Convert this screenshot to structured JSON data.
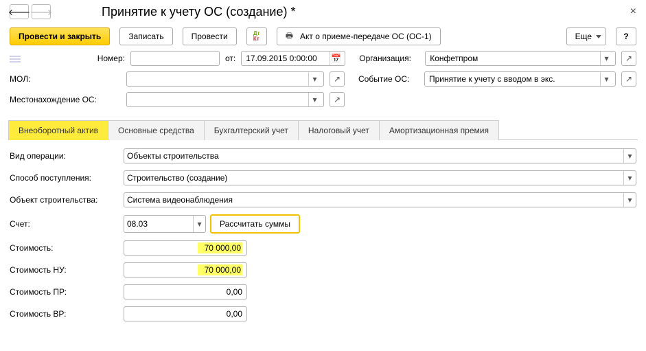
{
  "title": "Принятие к учету ОС (создание) *",
  "nav": {
    "back": "🡐",
    "fwd": "🡒"
  },
  "toolbar": {
    "primary": "Провести и закрыть",
    "save": "Записать",
    "post": "Провести",
    "dtk_top": "Дт",
    "dtk_bottom": "Кт",
    "print": "Акт о приеме-передаче ОС (ОС-1)",
    "more": "Еще",
    "help": "?"
  },
  "header": {
    "number_label": "Номер:",
    "number_value": "",
    "from_label": "от:",
    "date_value": "17.09.2015 0:00:00",
    "org_label": "Организация:",
    "org_value": "Конфетпром",
    "mol_label": "МОЛ:",
    "mol_value": "",
    "event_label": "Событие ОС:",
    "event_value": "Принятие к учету с вводом в экс.",
    "loc_label": "Местонахождение ОС:",
    "loc_value": ""
  },
  "tabs": [
    "Внеоборотный актив",
    "Основные средства",
    "Бухгалтерский учет",
    "Налоговый учет",
    "Амортизационная премия"
  ],
  "active_tab": 0,
  "vna": {
    "op_label": "Вид операции:",
    "op_value": "Объекты строительства",
    "method_label": "Способ поступления:",
    "method_value": "Строительство (создание)",
    "obj_label": "Объект строительства:",
    "obj_value": "Система видеонаблюдения",
    "acct_label": "Счет:",
    "acct_value": "08.03",
    "calc": "Рассчитать суммы",
    "cost_label": "Стоимость:",
    "cost_value": "70 000,00",
    "cost_nu_label": "Стоимость НУ:",
    "cost_nu_value": "70 000,00",
    "cost_pr_label": "Стоимость ПР:",
    "cost_pr_value": "0,00",
    "cost_vr_label": "Стоимость ВР:",
    "cost_vr_value": "0,00"
  },
  "icons": {
    "calendar": "📅",
    "dropdown": "▾",
    "ext": "↗",
    "close": "×"
  }
}
